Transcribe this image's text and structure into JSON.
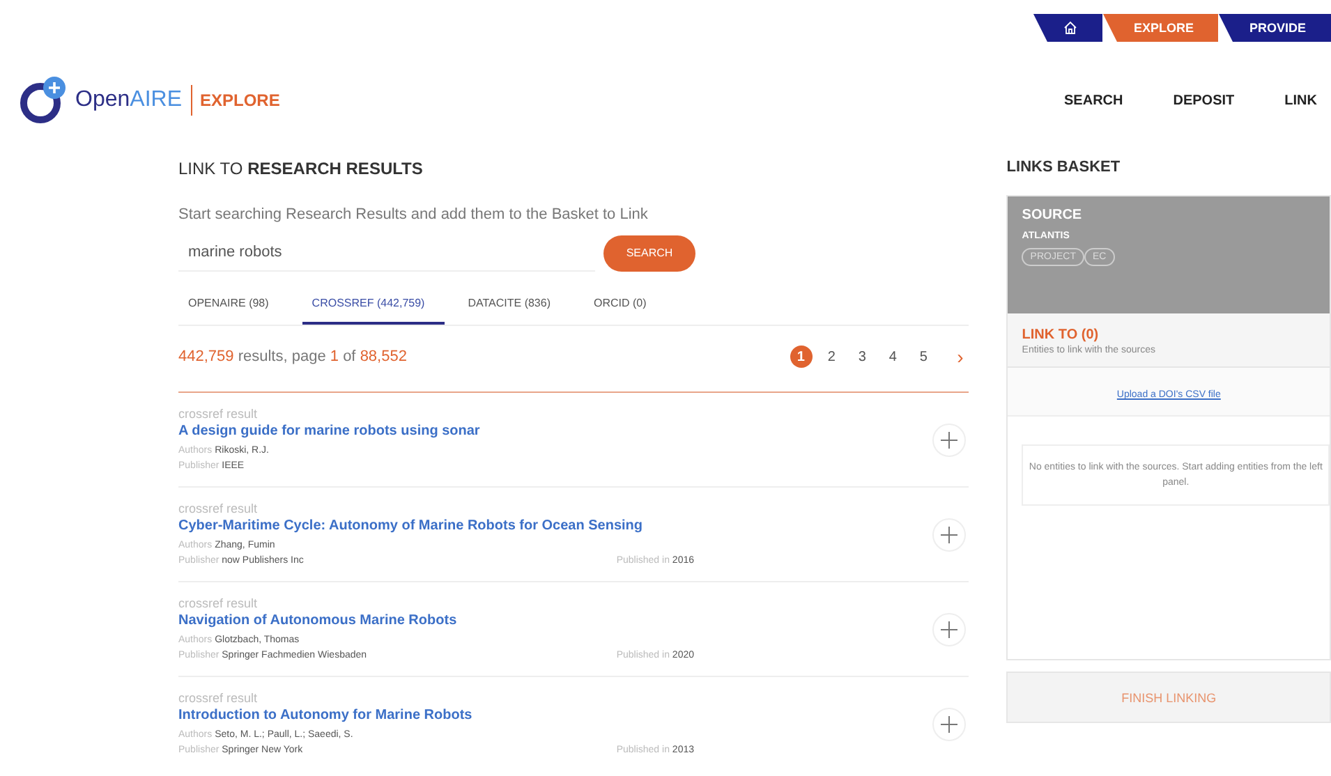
{
  "top_bar": [
    {
      "kind": "home",
      "selected": false
    },
    {
      "kind": "text",
      "label": "EXPLORE",
      "selected": true
    },
    {
      "kind": "text",
      "label": "PROVIDE",
      "selected": false
    }
  ],
  "logo": {
    "name_start": "Open",
    "name_end": "AIRE",
    "section": "EXPLORE"
  },
  "nav": [
    "SEARCH",
    "DEPOSIT",
    "LINK"
  ],
  "heading": {
    "prefix": "LINK TO",
    "emphasis": "RESEARCH RESULTS"
  },
  "description": "Start searching Research Results and add them to the Basket to Link",
  "search": {
    "value": "marine robots",
    "button": "SEARCH"
  },
  "tabs": [
    {
      "label": "OPENAIRE (98)",
      "selected": false
    },
    {
      "label": "CROSSREF (442,759)",
      "selected": true
    },
    {
      "label": "DATACITE (836)",
      "selected": false
    },
    {
      "label": "ORCID (0)",
      "selected": false
    }
  ],
  "summary": {
    "count": "442,759",
    "text_1": "results, page",
    "page": "1",
    "text_2": "of",
    "pages": "88,552"
  },
  "pagination": {
    "pages": [
      {
        "label": "1",
        "selected": true
      },
      {
        "label": "2",
        "selected": false
      },
      {
        "label": "3",
        "selected": false
      },
      {
        "label": "4",
        "selected": false
      },
      {
        "label": "5",
        "selected": false
      }
    ],
    "next": "›"
  },
  "results": [
    {
      "type": "crossref result",
      "title": "A design guide for marine robots using sonar",
      "authors_label": "Authors",
      "authors": "Rikoski, R.J.",
      "publisher_label": "Publisher",
      "publisher": "IEEE"
    },
    {
      "type": "crossref result",
      "title": "Cyber-Maritime Cycle: Autonomy of Marine Robots for Ocean Sensing",
      "authors_label": "Authors",
      "authors": "Zhang, Fumin",
      "publisher_label": "Publisher",
      "publisher": "now Publishers Inc",
      "published_label": "Published in",
      "published": "2016"
    },
    {
      "type": "crossref result",
      "title": "Navigation of Autonomous Marine Robots",
      "authors_label": "Authors",
      "authors": "Glotzbach, Thomas",
      "publisher_label": "Publisher",
      "publisher": "Springer Fachmedien Wiesbaden",
      "published_label": "Published in",
      "published": "2020"
    },
    {
      "type": "crossref result",
      "title": "Introduction to Autonomy for Marine Robots",
      "authors_label": "Authors",
      "authors": "Seto, M. L.; Paull, L.; Saeedi, S.",
      "publisher_label": "Publisher",
      "publisher": "Springer New York",
      "published_label": "Published in",
      "published": "2013"
    }
  ],
  "basket": {
    "title": "LINKS BASKET",
    "source_label": "SOURCE",
    "source_name": "ATLANTIS",
    "source_tags": [
      "PROJECT",
      "EC"
    ],
    "link_to": "LINK TO (0)",
    "link_to_hint": "Entities to link with the sources",
    "upload": "Upload a DOI's CSV file",
    "empty_message": "No entities to link with the sources. Start adding entities from the left panel.",
    "finish": "FINISH LINKING"
  }
}
